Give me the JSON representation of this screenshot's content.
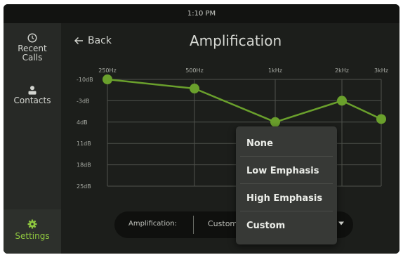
{
  "status_bar": {
    "time": "1:10 PM"
  },
  "sidebar": {
    "items": [
      {
        "label_line1": "Recent",
        "label_line2": "Calls",
        "icon": "clock-icon"
      },
      {
        "label": "Contacts",
        "icon": "person-icon"
      },
      {
        "label": "Settings",
        "icon": "gear-icon",
        "active": true
      }
    ]
  },
  "header": {
    "back_label": "Back",
    "title": "Amplification"
  },
  "colors": {
    "accent": "#8ec63f",
    "line": "#6aa02c",
    "background": "#1c1e1b",
    "menu": "#373936"
  },
  "chart_data": {
    "type": "line",
    "categories": [
      "250Hz",
      "500Hz",
      "1kHz",
      "2kHz",
      "3kHz"
    ],
    "y_ticks": [
      "-10dB",
      "-3dB",
      "4dB",
      "11dB",
      "18dB",
      "25dB"
    ],
    "ylim": [
      -10,
      25
    ],
    "y_inverted": true,
    "values": [
      -10,
      -7,
      4,
      -3,
      3
    ],
    "grid": true
  },
  "amplification_selector": {
    "label": "Amplification:",
    "value": "Custom"
  },
  "dropdown": {
    "options": [
      "None",
      "Low Emphasis",
      "High Emphasis",
      "Custom"
    ]
  }
}
